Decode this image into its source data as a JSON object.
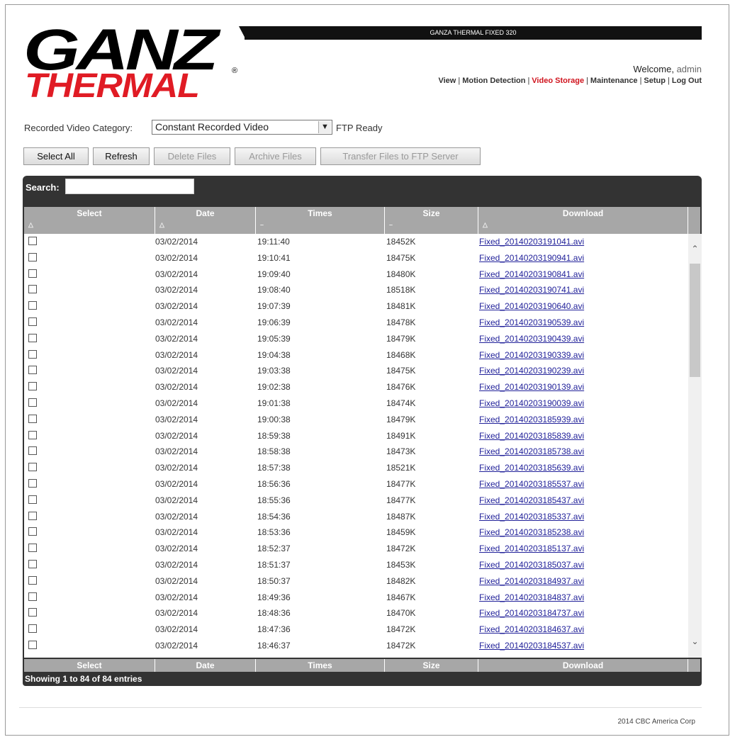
{
  "logo": {
    "line1": "GANZ",
    "line2": "THERMAL",
    "reg": "®"
  },
  "banner": {
    "title": "GANZA THERMAL FIXED 320"
  },
  "welcome": {
    "text": "Welcome,",
    "user": "admin"
  },
  "nav": {
    "items": [
      "View",
      "Motion Detection",
      "Video Storage",
      "Maintenance",
      "Setup",
      "Log Out"
    ],
    "active": "Video Storage"
  },
  "category": {
    "label": "Recorded Video Category:",
    "selected": "Constant Recorded Video",
    "status": "FTP Ready"
  },
  "buttons": {
    "select_all": "Select All",
    "refresh": "Refresh",
    "delete": "Delete Files",
    "archive": "Archive Files",
    "transfer": "Transfer Files to FTP Server"
  },
  "search": {
    "label": "Search:",
    "value": ""
  },
  "columns": [
    "Select",
    "Date",
    "Times",
    "Size",
    "Download"
  ],
  "rows": [
    {
      "date": "03/02/2014",
      "time": "19:11:40",
      "size": "18452K",
      "file": "Fixed_20140203191041.avi"
    },
    {
      "date": "03/02/2014",
      "time": "19:10:41",
      "size": "18475K",
      "file": "Fixed_20140203190941.avi"
    },
    {
      "date": "03/02/2014",
      "time": "19:09:40",
      "size": "18480K",
      "file": "Fixed_20140203190841.avi"
    },
    {
      "date": "03/02/2014",
      "time": "19:08:40",
      "size": "18518K",
      "file": "Fixed_20140203190741.avi"
    },
    {
      "date": "03/02/2014",
      "time": "19:07:39",
      "size": "18481K",
      "file": "Fixed_20140203190640.avi"
    },
    {
      "date": "03/02/2014",
      "time": "19:06:39",
      "size": "18478K",
      "file": "Fixed_20140203190539.avi"
    },
    {
      "date": "03/02/2014",
      "time": "19:05:39",
      "size": "18479K",
      "file": "Fixed_20140203190439.avi"
    },
    {
      "date": "03/02/2014",
      "time": "19:04:38",
      "size": "18468K",
      "file": "Fixed_20140203190339.avi"
    },
    {
      "date": "03/02/2014",
      "time": "19:03:38",
      "size": "18475K",
      "file": "Fixed_20140203190239.avi"
    },
    {
      "date": "03/02/2014",
      "time": "19:02:38",
      "size": "18476K",
      "file": "Fixed_20140203190139.avi"
    },
    {
      "date": "03/02/2014",
      "time": "19:01:38",
      "size": "18474K",
      "file": "Fixed_20140203190039.avi"
    },
    {
      "date": "03/02/2014",
      "time": "19:00:38",
      "size": "18479K",
      "file": "Fixed_20140203185939.avi"
    },
    {
      "date": "03/02/2014",
      "time": "18:59:38",
      "size": "18491K",
      "file": "Fixed_20140203185839.avi"
    },
    {
      "date": "03/02/2014",
      "time": "18:58:38",
      "size": "18473K",
      "file": "Fixed_20140203185738.avi"
    },
    {
      "date": "03/02/2014",
      "time": "18:57:38",
      "size": "18521K",
      "file": "Fixed_20140203185639.avi"
    },
    {
      "date": "03/02/2014",
      "time": "18:56:36",
      "size": "18477K",
      "file": "Fixed_20140203185537.avi"
    },
    {
      "date": "03/02/2014",
      "time": "18:55:36",
      "size": "18477K",
      "file": "Fixed_20140203185437.avi"
    },
    {
      "date": "03/02/2014",
      "time": "18:54:36",
      "size": "18487K",
      "file": "Fixed_20140203185337.avi"
    },
    {
      "date": "03/02/2014",
      "time": "18:53:36",
      "size": "18459K",
      "file": "Fixed_20140203185238.avi"
    },
    {
      "date": "03/02/2014",
      "time": "18:52:37",
      "size": "18472K",
      "file": "Fixed_20140203185137.avi"
    },
    {
      "date": "03/02/2014",
      "time": "18:51:37",
      "size": "18453K",
      "file": "Fixed_20140203185037.avi"
    },
    {
      "date": "03/02/2014",
      "time": "18:50:37",
      "size": "18482K",
      "file": "Fixed_20140203184937.avi"
    },
    {
      "date": "03/02/2014",
      "time": "18:49:36",
      "size": "18467K",
      "file": "Fixed_20140203184837.avi"
    },
    {
      "date": "03/02/2014",
      "time": "18:48:36",
      "size": "18470K",
      "file": "Fixed_20140203184737.avi"
    },
    {
      "date": "03/02/2014",
      "time": "18:47:36",
      "size": "18472K",
      "file": "Fixed_20140203184637.avi"
    },
    {
      "date": "03/02/2014",
      "time": "18:46:37",
      "size": "18472K",
      "file": "Fixed_20140203184537.avi"
    }
  ],
  "footer": {
    "showing": "Showing 1 to 84 of 84 entries"
  },
  "copyright": "2014 CBC America Corp",
  "colors": {
    "accent": "#d0141e",
    "panel": "#333333",
    "header": "#a7a7a7",
    "link": "#22229a"
  }
}
